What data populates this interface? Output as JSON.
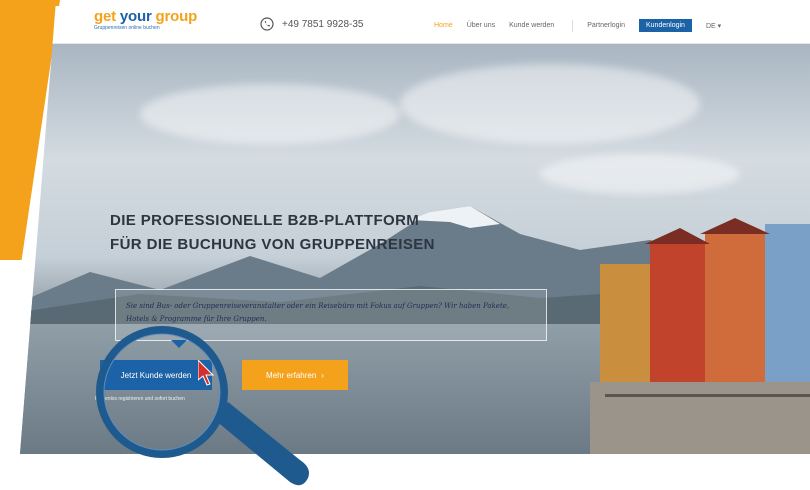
{
  "navbar": {
    "logo": {
      "part1": "get ",
      "part2": "your",
      "part3": " group",
      "tagline": "Gruppenreisen online buchen"
    },
    "phone": "+49 7851 9928-35",
    "links": [
      "Home",
      "Über uns",
      "Kunde werden"
    ],
    "partner_login": "Partnerlogin",
    "customer_login": "Kundenlogin",
    "language": "DE ▾"
  },
  "hero": {
    "title_line1": "DIE PROFESSIONELLE B2B-PLATTFORM",
    "title_line2": "FÜR DIE BUCHUNG VON GRUPPENREISEN",
    "description": "Sie sind Bus- oder Gruppenreiseveranstalter oder ein Reisebüro mit Fokus auf Gruppen? Wir haben Pakete, Hotels & Programme für Ihre Gruppen.",
    "primary_button": "Jetzt Kunde werden",
    "secondary_button": "Mehr erfahren",
    "secondary_icon": "chevron-right-icon",
    "subtext": "Kostenlos registrieren und sofort buchen"
  },
  "colors": {
    "accent_orange": "#f4a21b",
    "brand_blue": "#1c62a6",
    "magnifier": "#1f5a8f"
  }
}
